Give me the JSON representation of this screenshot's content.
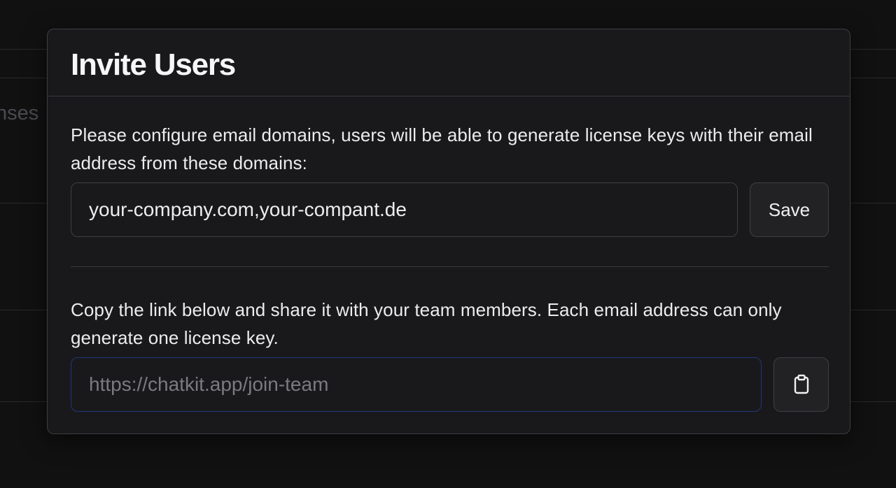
{
  "background": {
    "partial_text": "nses"
  },
  "dialog": {
    "title": "Invite Users",
    "domains_section": {
      "description": "Please configure email domains, users will be able to generate license keys with their email address from these domains:",
      "input_value": "your-company.com,your-compant.de",
      "save_label": "Save"
    },
    "link_section": {
      "description": "Copy the link below and share it with your team members. Each email address can only generate one license key.",
      "link_placeholder": "https://chatkit.app/join-team",
      "copy_icon": "clipboard-icon"
    }
  },
  "colors": {
    "focus_border": "#23357a",
    "dialog_bg": "#19191b",
    "page_bg": "#111112"
  }
}
